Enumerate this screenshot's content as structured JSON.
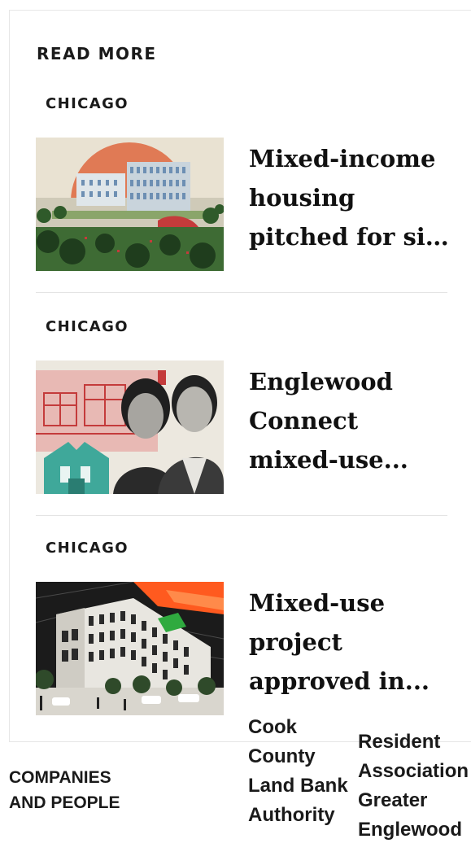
{
  "section": {
    "title": "READ MORE"
  },
  "articles": [
    {
      "category": "CHICAGO",
      "headline": "Mixed-income housing pitched for site near..."
    },
    {
      "category": "CHICAGO",
      "headline": "Englewood Connect mixed-use..."
    },
    {
      "category": "CHICAGO",
      "headline": "Mixed-use project approved in..."
    }
  ],
  "tags": {
    "companies_and_people": "COMPANIES AND PEOPLE",
    "cook_county": "Cook County Land Bank Authority",
    "resident_association": "Resident Association of Greater Englewood"
  },
  "colors": {
    "sun_orange": "#e07a55",
    "red_accent": "#c43b3b",
    "teal_accent": "#3fa89a",
    "green_roof": "#2faa3f",
    "orange_glow": "#ff5a1f"
  }
}
